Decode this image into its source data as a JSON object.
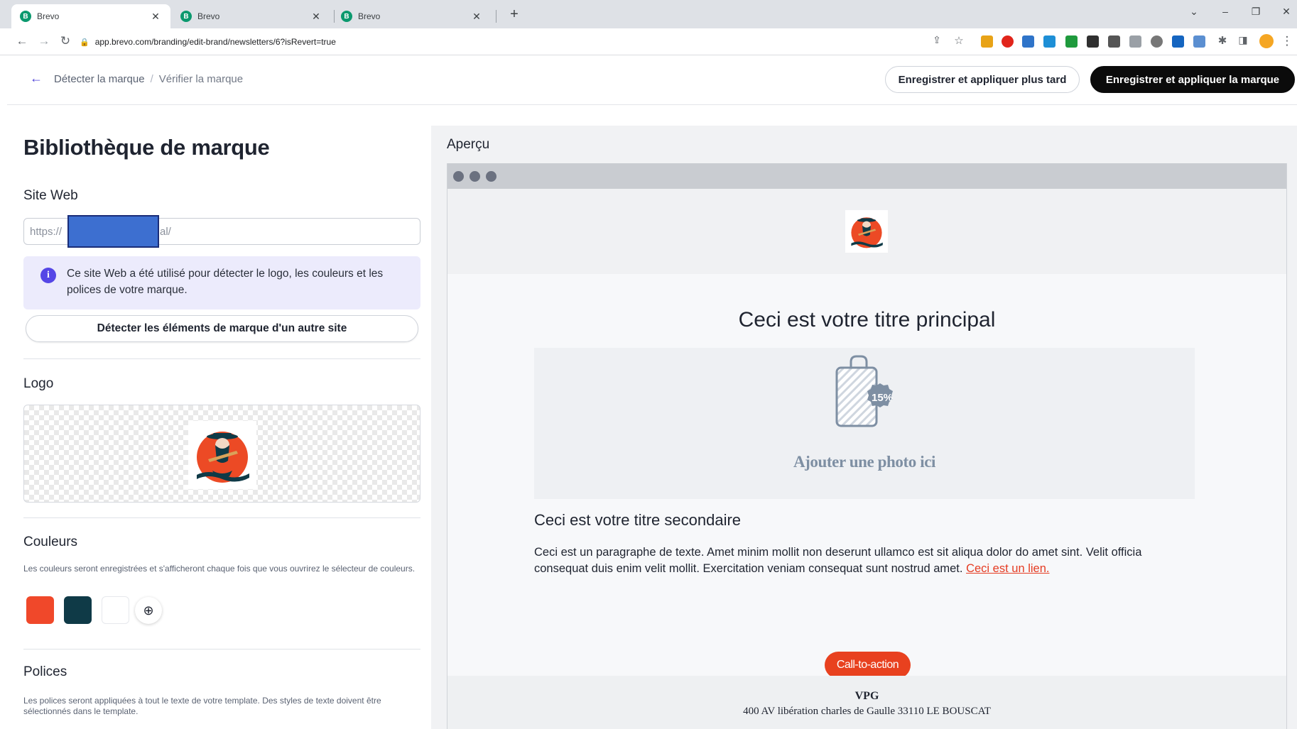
{
  "browser": {
    "tabs": [
      {
        "title": "Brevo",
        "favicon": "B"
      },
      {
        "title": "Brevo",
        "favicon": "B"
      },
      {
        "title": "Brevo",
        "favicon": "B"
      }
    ],
    "new_tab": "+",
    "url": "app.brevo.com/branding/edit-brand/newsletters/6?isRevert=true"
  },
  "header": {
    "breadcrumb": [
      "Détecter la marque",
      "Vérifier la marque"
    ],
    "separator": "/",
    "save_later_label": "Enregistrer et appliquer plus tard",
    "save_apply_label": "Enregistrer et appliquer la marque"
  },
  "library": {
    "title": "Bibliothèque de marque",
    "website": {
      "label": "Site Web",
      "value_prefix": "https://",
      "value_suffix": "al/",
      "info": "Ce site Web a été utilisé pour détecter le logo, les couleurs et les polices de votre marque.",
      "detect_button": "Détecter les éléments de marque d'un autre site"
    },
    "logo": {
      "label": "Logo"
    },
    "colors": {
      "label": "Couleurs",
      "help": "Les couleurs seront enregistrées et s'afficheront chaque fois que vous ouvrirez le sélecteur de couleurs.",
      "swatches": [
        "#f0482a",
        "#0f3a47",
        "#ffffff"
      ]
    },
    "fonts": {
      "label": "Polices",
      "help": "Les polices seront appliquées à tout le texte de votre template. Des styles de texte doivent être sélectionnés dans le template."
    }
  },
  "preview": {
    "label": "Aperçu",
    "main_title": "Ceci est votre titre principal",
    "badge": "15%",
    "photo_caption": "Ajouter une photo ici",
    "secondary_title": "Ceci est votre titre secondaire",
    "paragraph": "Ceci est un paragraphe de texte. Amet minim mollit non deserunt ullamco est sit aliqua dolor do amet sint. Velit officia consequat duis enim velit mollit. Exercitation veniam consequat sunt nostrud amet.",
    "link": "Ceci est un lien.",
    "cta": "Call-to-action",
    "company": "VPG",
    "address": "400 AV libération charles de Gaulle  33110  LE BOUSCAT"
  }
}
